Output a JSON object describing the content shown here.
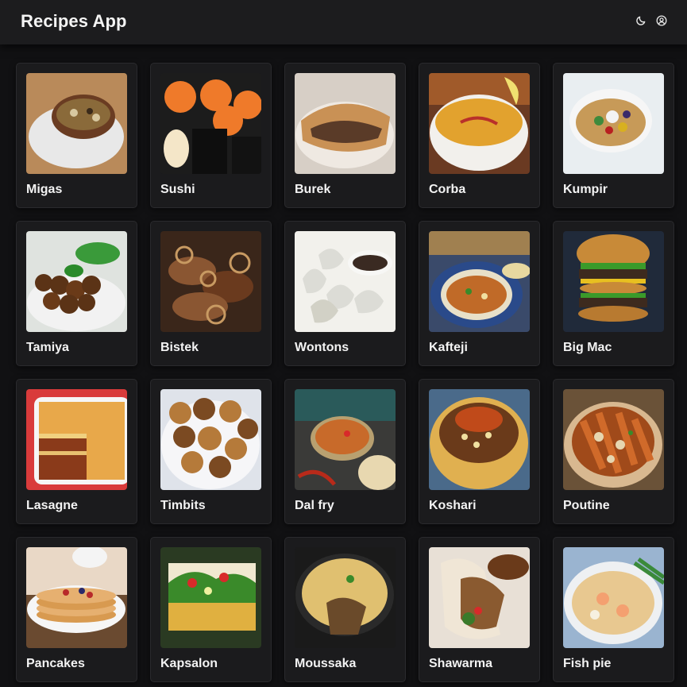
{
  "app": {
    "title": "Recipes App"
  },
  "header": {
    "icons": [
      "moon-icon",
      "user-circle-icon"
    ]
  },
  "recipes": [
    {
      "name": "Migas"
    },
    {
      "name": "Sushi"
    },
    {
      "name": "Burek"
    },
    {
      "name": "Corba"
    },
    {
      "name": "Kumpir"
    },
    {
      "name": "Tamiya"
    },
    {
      "name": "Bistek"
    },
    {
      "name": "Wontons"
    },
    {
      "name": "Kafteji"
    },
    {
      "name": "Big Mac"
    },
    {
      "name": "Lasagne"
    },
    {
      "name": "Timbits"
    },
    {
      "name": "Dal fry"
    },
    {
      "name": "Koshari"
    },
    {
      "name": "Poutine"
    },
    {
      "name": "Pancakes"
    },
    {
      "name": "Kapsalon"
    },
    {
      "name": "Moussaka"
    },
    {
      "name": "Shawarma"
    },
    {
      "name": "Fish pie"
    }
  ],
  "colors": {
    "background": "#111113",
    "header": "#1c1c1e",
    "card": "#1b1b1d",
    "text": "#f3f3f3"
  }
}
